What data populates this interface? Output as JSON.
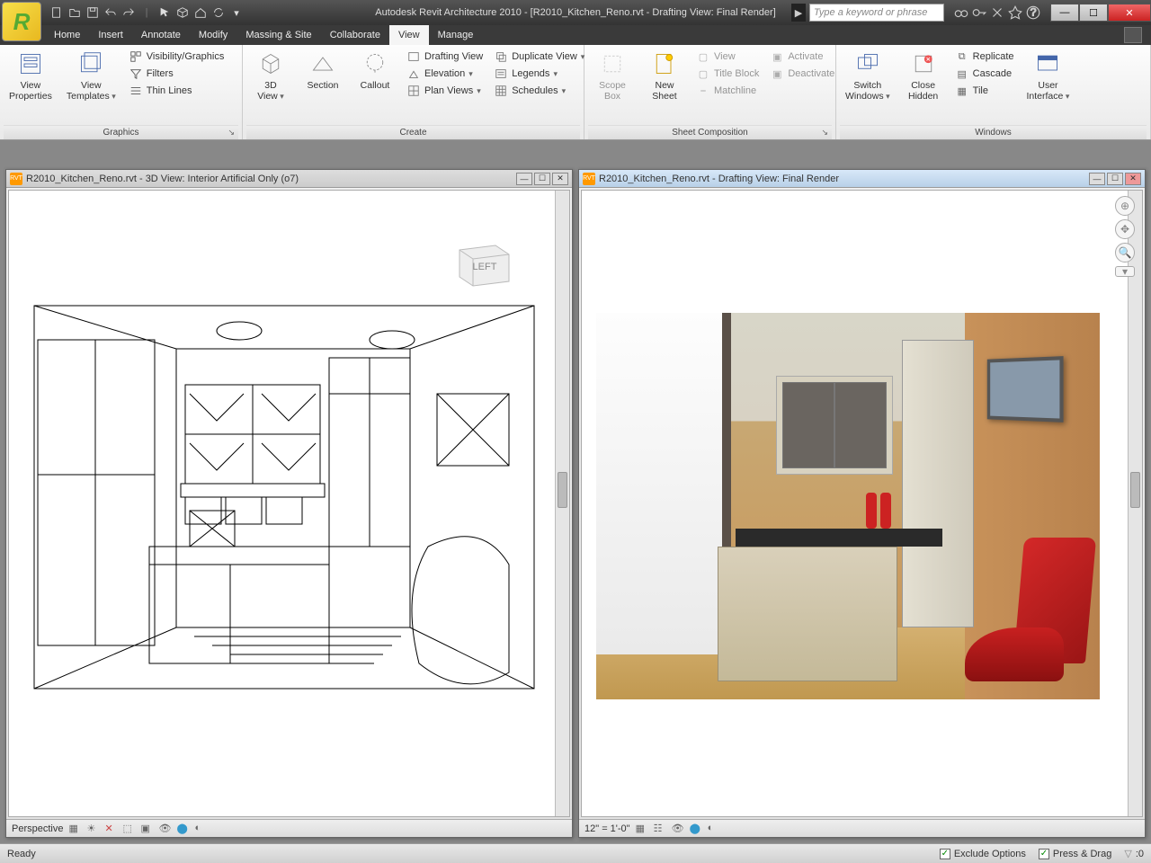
{
  "app": {
    "title": "Autodesk Revit Architecture 2010 - [R2010_Kitchen_Reno.rvt - Drafting View: Final Render]",
    "logo": "R"
  },
  "search": {
    "placeholder": "Type a keyword or phrase"
  },
  "menu": {
    "items": [
      "Home",
      "Insert",
      "Annotate",
      "Modify",
      "Massing & Site",
      "Collaborate",
      "View",
      "Manage"
    ],
    "active": "View"
  },
  "ribbon": {
    "graphics": {
      "label": "Graphics",
      "view_props": "View\nProperties",
      "view_templates": "View\nTemplates",
      "vis": "Visibility/Graphics",
      "filters": "Filters",
      "thin": "Thin Lines"
    },
    "create": {
      "label": "Create",
      "three_d": "3D\nView",
      "section": "Section",
      "callout": "Callout",
      "drafting": "Drafting View",
      "elevation": "Elevation",
      "plan": "Plan Views",
      "dup": "Duplicate View",
      "legends": "Legends",
      "schedules": "Schedules"
    },
    "sheet": {
      "label": "Sheet Composition",
      "scope": "Scope\nBox",
      "new_sheet": "New\nSheet",
      "view": "View",
      "title": "Title Block",
      "match": "Matchline",
      "activate": "Activate",
      "deactivate": "Deactivate"
    },
    "windows": {
      "label": "Windows",
      "switch": "Switch\nWindows",
      "close": "Close\nHidden",
      "replicate": "Replicate",
      "cascade": "Cascade",
      "tile": "Tile",
      "ui": "User\nInterface"
    }
  },
  "docs": {
    "left": {
      "title": "R2010_Kitchen_Reno.rvt - 3D View: Interior Artificial Only (o7)",
      "status": "Perspective",
      "cube": "LEFT"
    },
    "right": {
      "title": "R2010_Kitchen_Reno.rvt - Drafting View: Final Render",
      "status": "12\" = 1'-0\""
    }
  },
  "status": {
    "ready": "Ready",
    "exclude": "Exclude Options",
    "press": "Press & Drag",
    "filter": ":0"
  }
}
